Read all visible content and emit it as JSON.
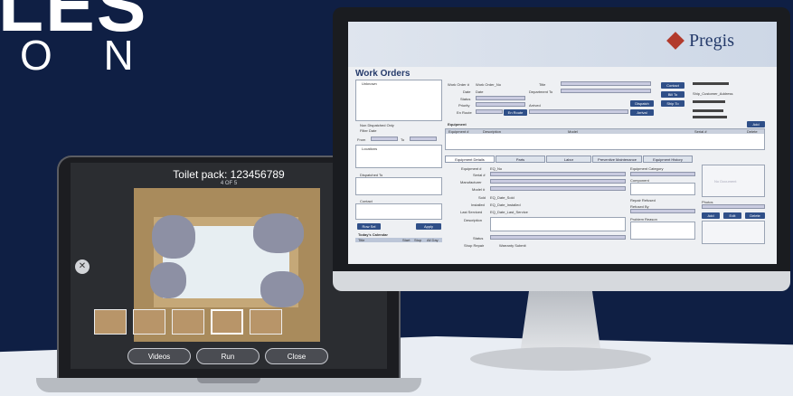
{
  "banner": {
    "hero_text": "LES",
    "subtitle": "O N"
  },
  "laptop": {
    "title": "Toilet pack: 123456789",
    "counter": "4 OF 5",
    "buttons": [
      "Videos",
      "Run",
      "Close"
    ]
  },
  "monitor": {
    "brand": "Pregis",
    "page_title": "Work Orders",
    "filters": {
      "unclaimed_label": "Unknown",
      "non_dispatched": "Non Dispatched Only",
      "filter_date": "Filter Date",
      "from": "From",
      "to": "To",
      "locations": "Locations",
      "dispatched_to": "Dispatched To",
      "contact": "Contact",
      "row_sel": "Row Sel",
      "apply": "Apply",
      "todays_calendar": "Today's Calendar",
      "cal_cols": [
        "Title",
        "Start",
        "Stop",
        "All Day"
      ]
    },
    "header_fields": {
      "work_order": "Work Order #",
      "work_order_value": "Work Order_No",
      "date": "Date",
      "date_value": "Date",
      "status": "Status",
      "priority": "Priority",
      "on_route": "En Route",
      "title": "Title",
      "department_to": "Department To",
      "arrived": "Arrived",
      "contact_btn": "Contact",
      "dispatch_btn": "Dispatch",
      "arrival_btn": "Arrival",
      "en_route_btn": "En Route",
      "bill_to": "Bill To",
      "ship_to": "Ship To"
    },
    "ship_info": [
      "Ship_Customer_Address"
    ],
    "equipment": {
      "title": "Equipment",
      "add": "Add",
      "cols": [
        "Equipment #",
        "Description",
        "Model",
        "Serial #",
        "Delete"
      ]
    },
    "tabs": [
      "Equipment Details",
      "Parts",
      "Labor",
      "Preventive Maintenance",
      "Equipment History"
    ],
    "details": {
      "equipment": "Equipment #",
      "eq_value": "EQ_No",
      "serial": "Serial #",
      "manufacturer": "Manufacturer",
      "model": "Model #",
      "sold": "Sold",
      "sold_value": "EQ_Date_Sold",
      "installed": "Installed",
      "installed_value": "EQ_Date_Installed",
      "last_serviced": "Last Serviced",
      "last_serviced_value": "EQ_Date_Last_Service",
      "description": "Description",
      "status": "Status",
      "shop_repair": "Shop Repair",
      "warranty_submit": "Warranty Submit",
      "equipment_category": "Equipment Category",
      "component": "Component",
      "repair_refused": "Repair Refused",
      "refused_by": "Refused By",
      "photos": "Photos",
      "actions": [
        "Add",
        "Edit",
        "Delete"
      ],
      "problem_reason": "Problem Reason",
      "no_document": "No Document"
    }
  },
  "colors": {
    "background": "#0f1f44",
    "accent": "#2f4f88",
    "brand_red": "#b23a2c"
  }
}
